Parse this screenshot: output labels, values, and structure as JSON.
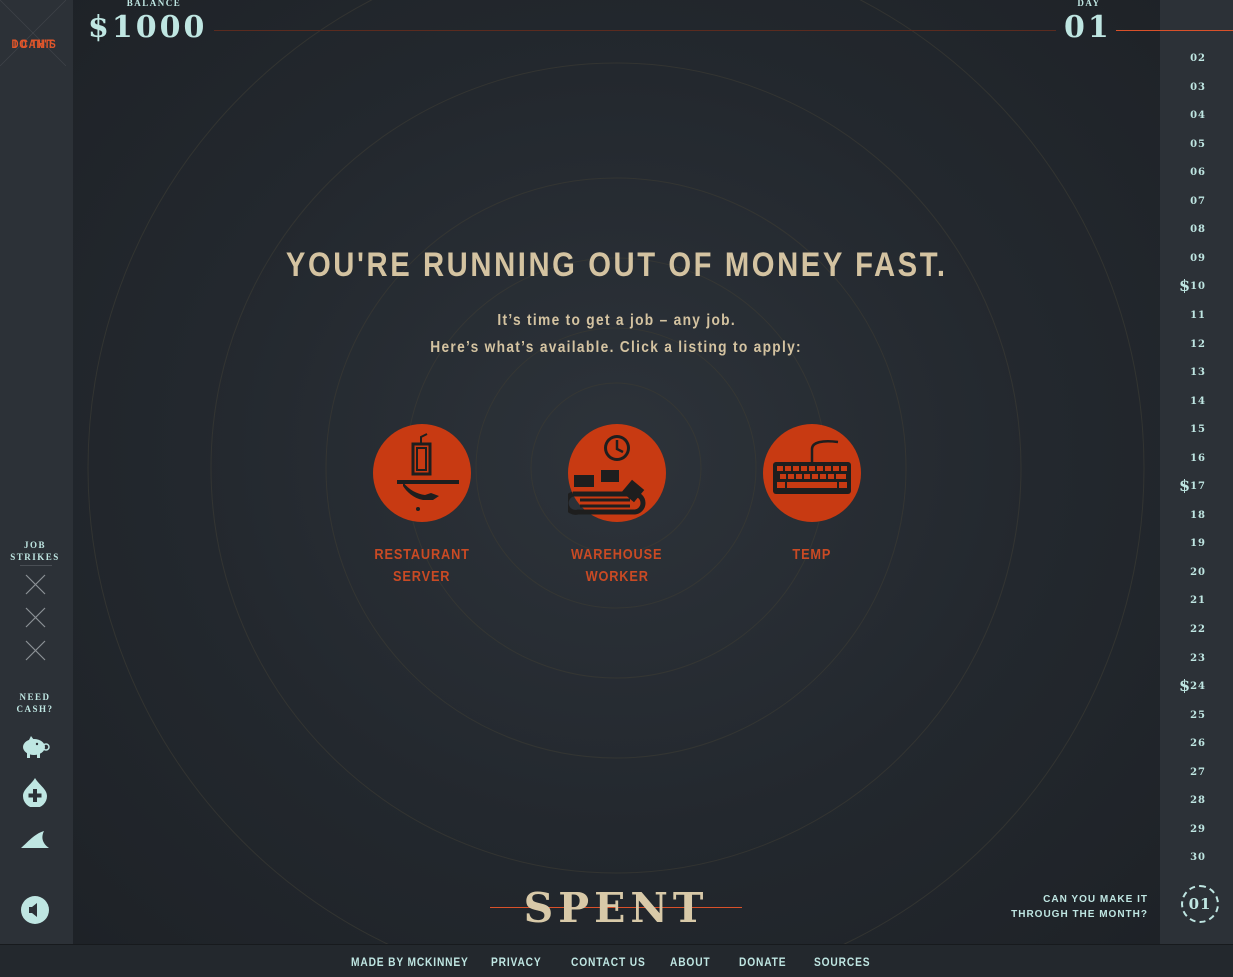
{
  "sidebar": {
    "quit_label_line1": "I CAN'T",
    "quit_label_line2": "DO THIS",
    "strikes_heading_line1": "JOB",
    "strikes_heading_line2": "STRIKES",
    "cash_heading_line1": "NEED",
    "cash_heading_line2": "CASH?",
    "cash_icons": [
      "piggy-bank-icon",
      "blood-drop-plus-icon",
      "shark-fin-icon"
    ],
    "sound_icon": "speaker-icon"
  },
  "header": {
    "balance_label": "BALANCE",
    "balance_value": "$1000",
    "day_label": "DAY",
    "day_value": "01"
  },
  "days": [
    {
      "num": "02",
      "pay": false
    },
    {
      "num": "03",
      "pay": false
    },
    {
      "num": "04",
      "pay": false
    },
    {
      "num": "05",
      "pay": false
    },
    {
      "num": "06",
      "pay": false
    },
    {
      "num": "07",
      "pay": false
    },
    {
      "num": "08",
      "pay": false
    },
    {
      "num": "09",
      "pay": false
    },
    {
      "num": "10",
      "pay": true
    },
    {
      "num": "11",
      "pay": false
    },
    {
      "num": "12",
      "pay": false
    },
    {
      "num": "13",
      "pay": false
    },
    {
      "num": "14",
      "pay": false
    },
    {
      "num": "15",
      "pay": false
    },
    {
      "num": "16",
      "pay": false
    },
    {
      "num": "17",
      "pay": true
    },
    {
      "num": "18",
      "pay": false
    },
    {
      "num": "19",
      "pay": false
    },
    {
      "num": "20",
      "pay": false
    },
    {
      "num": "21",
      "pay": false
    },
    {
      "num": "22",
      "pay": false
    },
    {
      "num": "23",
      "pay": false
    },
    {
      "num": "24",
      "pay": true
    },
    {
      "num": "25",
      "pay": false
    },
    {
      "num": "26",
      "pay": false
    },
    {
      "num": "27",
      "pay": false
    },
    {
      "num": "28",
      "pay": false
    },
    {
      "num": "29",
      "pay": false
    },
    {
      "num": "30",
      "pay": false
    }
  ],
  "pay_symbol": "$",
  "main": {
    "headline": "YOU'RE RUNNING OUT OF MONEY FAST.",
    "sub1": "It’s time to get a job – any job.",
    "sub2": "Here’s what’s available. Click a listing to apply:",
    "jobs": [
      {
        "icon": "server-tray-icon",
        "line1": "RESTAURANT",
        "line2": "SERVER"
      },
      {
        "icon": "warehouse-conveyor-icon",
        "line1": "WAREHOUSE",
        "line2": "WORKER"
      },
      {
        "icon": "keyboard-icon",
        "line1": "TEMP",
        "line2": ""
      }
    ]
  },
  "month": {
    "question_line1": "CAN YOU MAKE IT",
    "question_line2": "THROUGH THE MONTH?",
    "badge": "01"
  },
  "logo": "SPENT",
  "footer": {
    "links": [
      "MADE BY MCKINNEY",
      "PRIVACY",
      "CONTACT US",
      "ABOUT",
      "DONATE",
      "SOURCES"
    ]
  },
  "colors": {
    "accent": "#c83a12",
    "teal_text": "#bfe6e2",
    "cream_text": "#d4c3a1"
  }
}
